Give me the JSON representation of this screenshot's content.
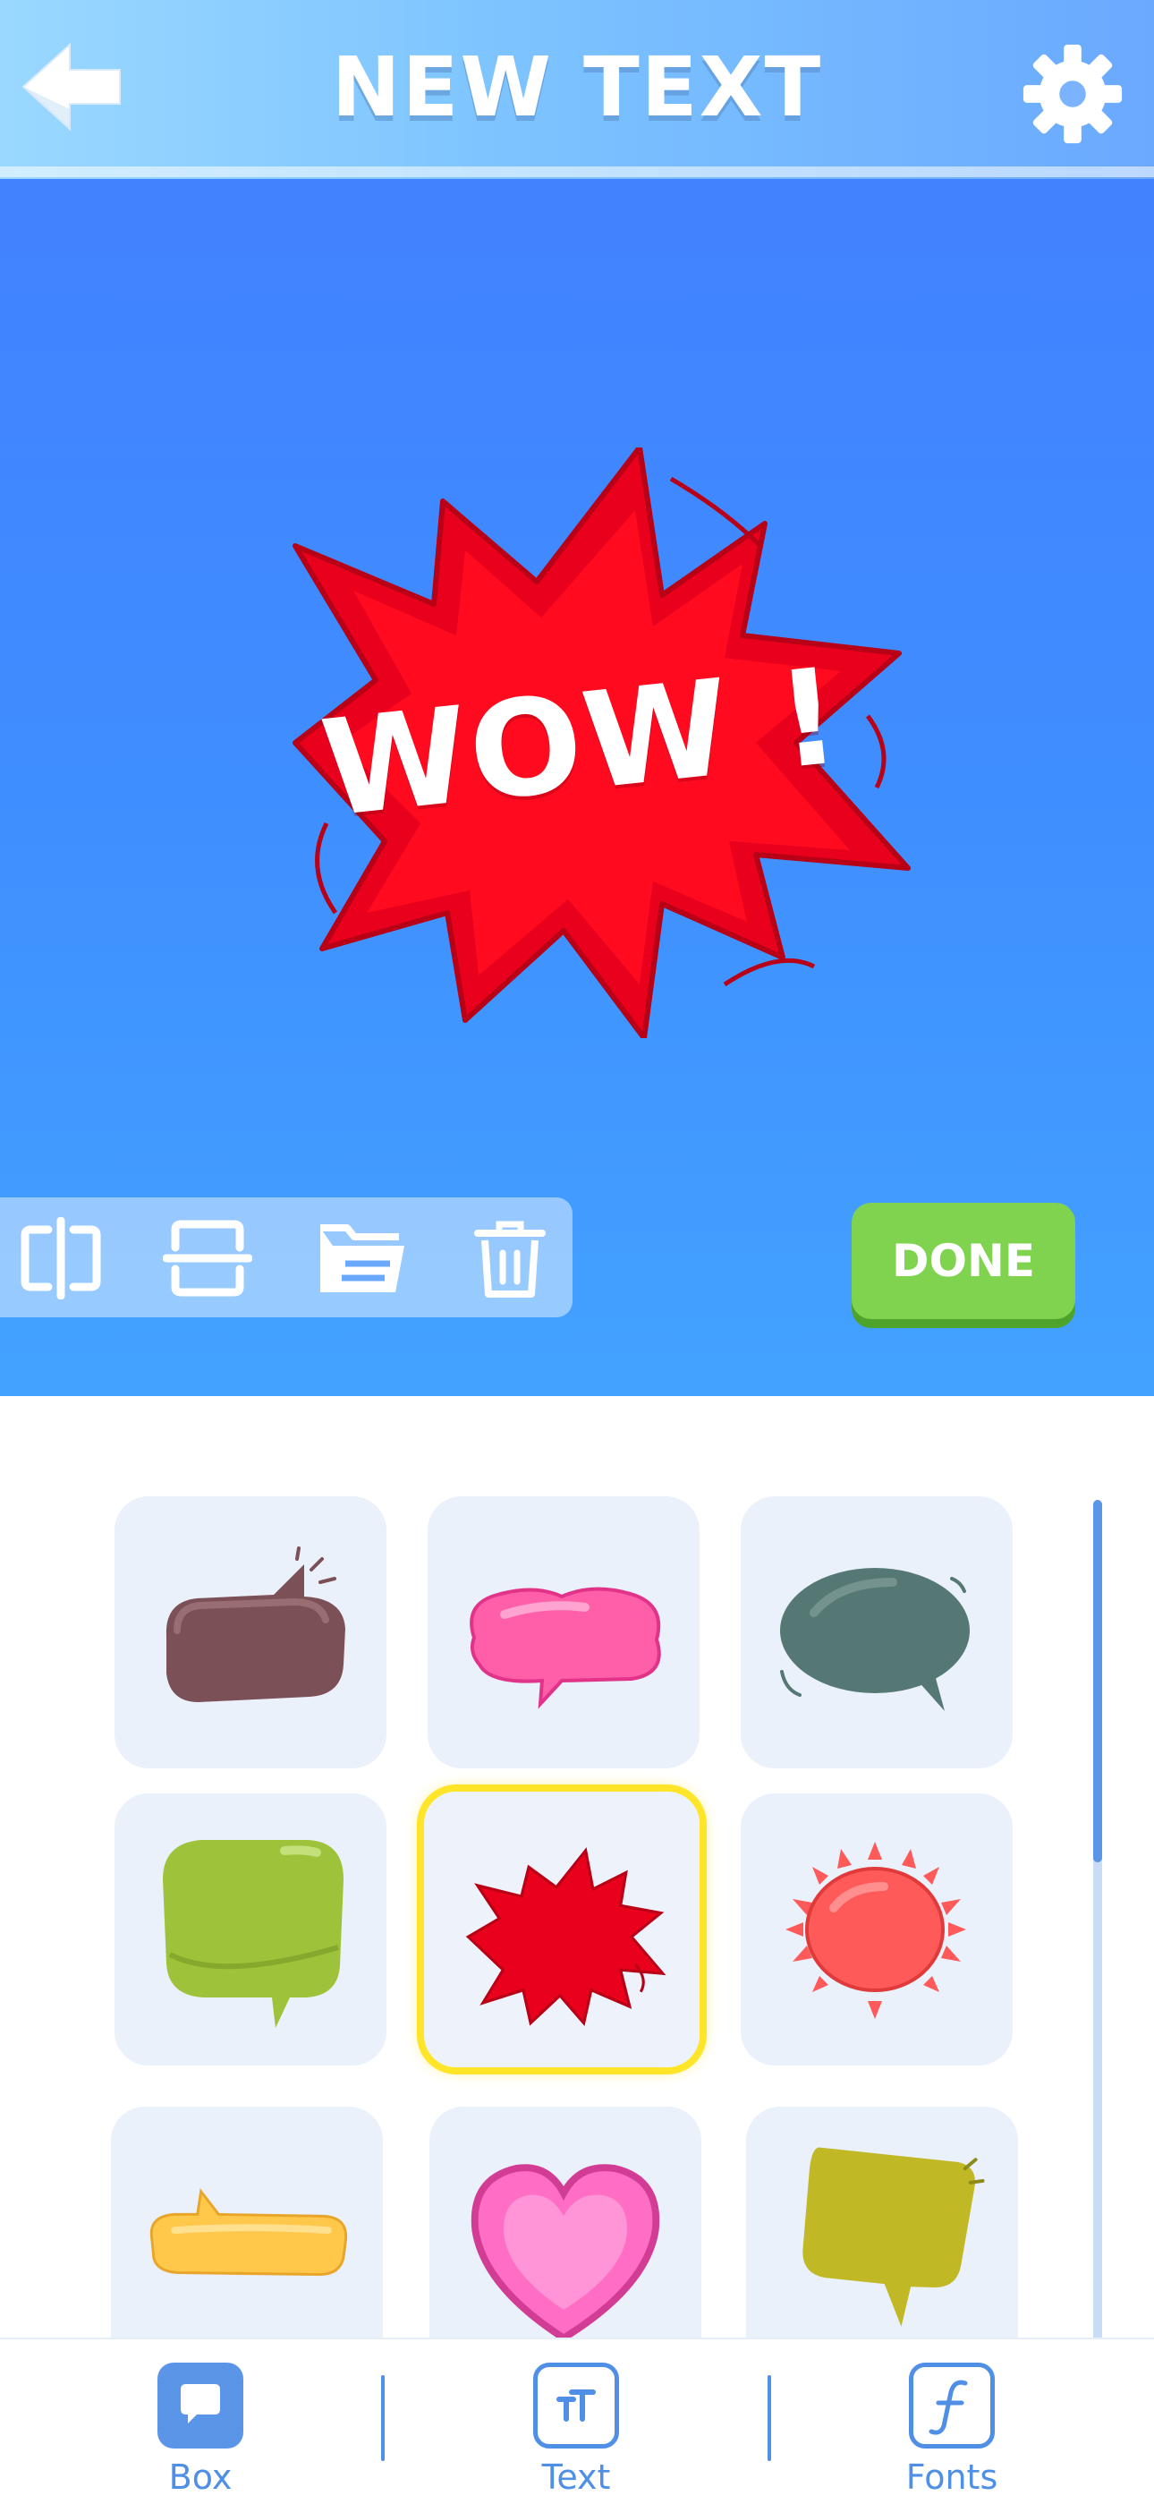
{
  "header": {
    "title": "NEW TEXT",
    "back_icon": "back-arrow-icon",
    "settings_icon": "gear-icon"
  },
  "canvas": {
    "bubble_text": "WOW !",
    "bubble_style": "red-burst",
    "toolbar": {
      "tools": [
        "flip-horizontal-icon",
        "flip-vertical-icon",
        "layers-icon",
        "trash-icon"
      ]
    },
    "done_label": "DONE"
  },
  "bubbles": {
    "selected_index": 4,
    "items": [
      {
        "style": "mauve-speech-bubble",
        "color": "#7b5057"
      },
      {
        "style": "pink-cloud-bubble",
        "color": "#ff5fa8"
      },
      {
        "style": "slate-speech-bubble",
        "color": "#567874"
      },
      {
        "style": "green-speech-bubble",
        "color": "#9ec23a"
      },
      {
        "style": "red-burst-bubble",
        "color": "#e8001c"
      },
      {
        "style": "sun-bubble",
        "color": "#ff5a5a"
      },
      {
        "style": "yellow-pill-bubble",
        "color": "#ffc84a"
      },
      {
        "style": "pink-heart-bubble",
        "color": "#ff6ec4"
      },
      {
        "style": "olive-speech-bubble",
        "color": "#c1b826"
      }
    ]
  },
  "nav": {
    "items": [
      {
        "label": "Box",
        "icon": "chat-bubble-icon",
        "active": true
      },
      {
        "label": "Text",
        "icon": "text-size-icon",
        "active": false
      },
      {
        "label": "Fonts",
        "icon": "font-icon",
        "active": false
      }
    ]
  },
  "colors": {
    "accent": "#4f8fe6",
    "done_green": "#7fd34f",
    "selected_outline": "#ffe52a",
    "burst_red": "#e8001c"
  }
}
